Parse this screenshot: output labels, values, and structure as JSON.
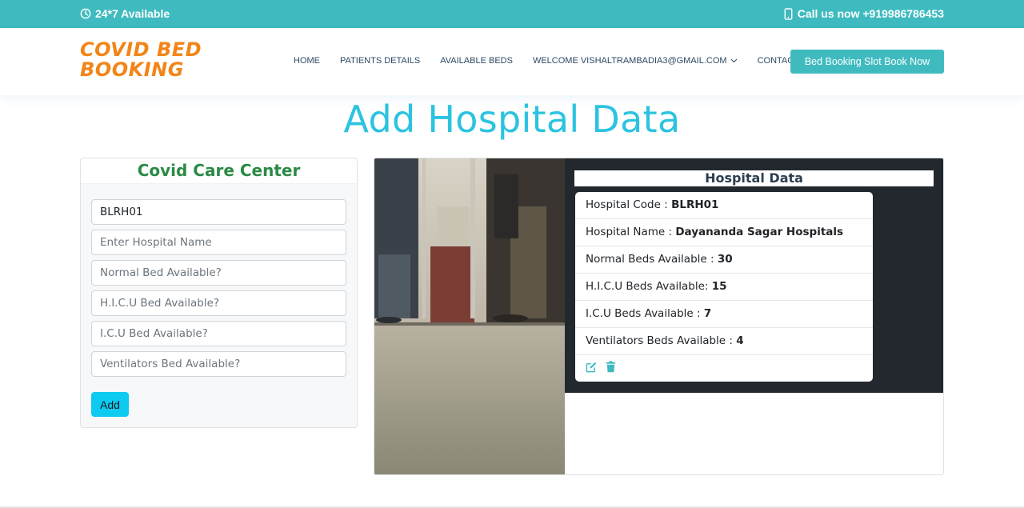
{
  "topbar": {
    "availability": "24*7 Available",
    "call": "Call us now +919986786453",
    "availability_icon": "clock-icon",
    "call_icon": "phone-icon"
  },
  "header": {
    "logo_line1": "COVID BED",
    "logo_line2": "BOOKING",
    "nav": [
      {
        "label": "HOME"
      },
      {
        "label": "PATIENTS DETAILS"
      },
      {
        "label": "AVAILABLE BEDS"
      },
      {
        "label": "WELCOME VISHALTRAMBADIA3@GMAIL.COM"
      },
      {
        "label": "CONTACT"
      }
    ],
    "cta": "Bed Booking Slot Book Now"
  },
  "page": {
    "title": "Add Hospital Data"
  },
  "form": {
    "heading": "Covid Care Center",
    "hospital_code_value": "BLRH01",
    "hospital_name_placeholder": "Enter Hospital Name",
    "normal_bed_placeholder": "Normal Bed Available?",
    "hicu_bed_placeholder": "H.I.C.U Bed Available?",
    "icu_bed_placeholder": "I.C.U Bed Available?",
    "ventilator_bed_placeholder": "Ventilators Bed Available?",
    "submit_label": "Add"
  },
  "hospital_data": {
    "title": "Hospital Data",
    "rows": [
      {
        "label": "Hospital Code : ",
        "value": "BLRH01"
      },
      {
        "label": "Hospital Name : ",
        "value": "Dayananda Sagar Hospitals"
      },
      {
        "label": "Normal Beds Available : ",
        "value": "30"
      },
      {
        "label": "H.I.C.U Beds Available: ",
        "value": "15"
      },
      {
        "label": "I.C.U Beds Available : ",
        "value": "7"
      },
      {
        "label": "Ventilators Beds Available : ",
        "value": "4"
      }
    ],
    "edit_icon": "edit-icon",
    "delete_icon": "trash-icon"
  },
  "colors": {
    "brand_teal": "#3fbbc0",
    "logo_orange": "#f28518",
    "title_cyan": "#2cc3e0",
    "heading_green": "#2a8a45",
    "button_cyan": "#0dcaf0",
    "dark_panel": "#22282e"
  }
}
